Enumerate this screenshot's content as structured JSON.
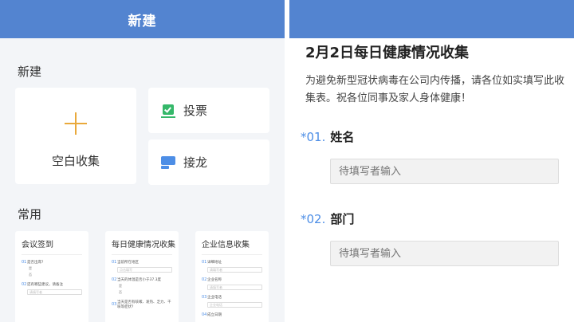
{
  "left": {
    "header_title": "新建",
    "new_section_title": "新建",
    "blank_label": "空白收集",
    "vote_label": "投票",
    "chain_label": "接龙",
    "common_section_title": "常用",
    "templates": [
      {
        "title": "会议签到",
        "rows": [
          {
            "num": "01",
            "q": "是否出席?",
            "options": [
              "是",
              "否"
            ]
          },
          {
            "num": "02",
            "q": "还有哪些建议，请备注",
            "input": "请填写者"
          }
        ]
      },
      {
        "title": "每日健康情况收集",
        "rows": [
          {
            "num": "01",
            "q": "当前所在地区",
            "input": "点击填写"
          },
          {
            "num": "02",
            "q": "当天的体温是否小于37.3度",
            "options": [
              "是",
              "否"
            ]
          },
          {
            "num": "03",
            "q": "当天是否有咳嗽、发热、乏力、干咳等症状?",
            "options": []
          }
        ]
      },
      {
        "title": "企业信息收集",
        "rows": [
          {
            "num": "01",
            "q": "详细地址",
            "input": "请填写者"
          },
          {
            "num": "02",
            "q": "企业名称",
            "input": "请填写者"
          },
          {
            "num": "03",
            "q": "企业电话",
            "input": "企业电话"
          },
          {
            "num": "04",
            "q": "成立日期",
            "options": []
          }
        ]
      }
    ]
  },
  "right": {
    "form_title": "2月2日每日健康情况收集",
    "form_desc": "为避免新型冠状病毒在公司内传播，请各位如实填写此收集表。祝各位同事及家人身体健康！",
    "questions": [
      {
        "required": "*",
        "num": "01.",
        "label": "姓名",
        "placeholder": "待填写者输入"
      },
      {
        "required": "*",
        "num": "02.",
        "label": "部门",
        "placeholder": "待填写者输入"
      }
    ]
  },
  "colors": {
    "accent": "#5384d0",
    "plus": "#e9a93b",
    "vote": "#35b86a",
    "chain": "#4d8ee6"
  },
  "icons": {
    "blank": "plus-icon",
    "vote": "vote-check-icon",
    "chain": "chain-message-icon"
  }
}
